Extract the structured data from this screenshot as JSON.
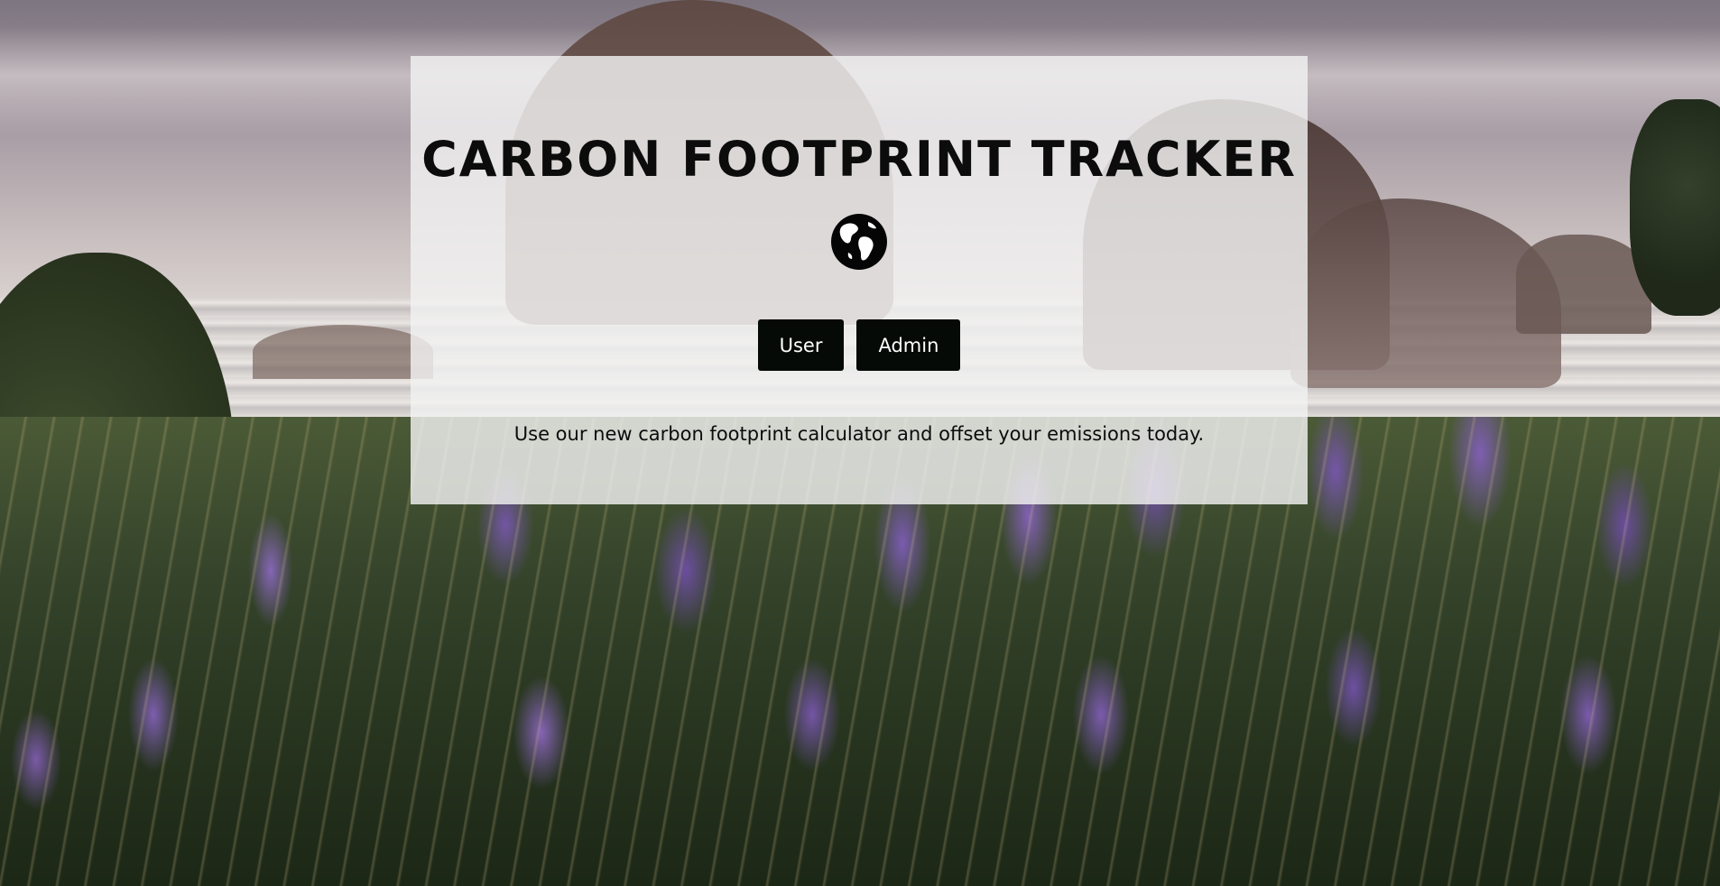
{
  "app": {
    "title": "CARBON FOOTPRINT TRACKER",
    "logo_icon": "globe-icon",
    "buttons": {
      "user_label": "User",
      "admin_label": "Admin"
    },
    "tagline": "Use our new carbon footprint calculator and offset your emissions today."
  },
  "background": {
    "description_icon": "landscape-background"
  },
  "colors": {
    "panel": "#f2f2f2",
    "button_bg": "#050a07",
    "button_text": "#ffffff",
    "text": "#0c0c0c"
  }
}
